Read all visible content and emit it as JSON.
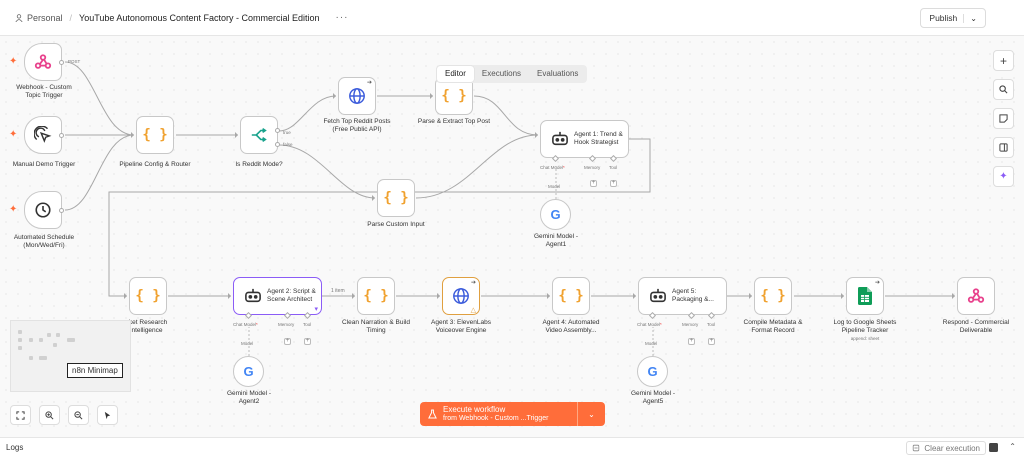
{
  "header": {
    "workspace": "Personal",
    "title": "YouTube Autonomous Content Factory - Commercial Edition",
    "more": "···",
    "publish_label": "Publish",
    "publish_caret": "⌄"
  },
  "tabs": [
    {
      "label": "Editor",
      "active": true
    },
    {
      "label": "Executions",
      "active": false
    },
    {
      "label": "Evaluations",
      "active": false
    }
  ],
  "nodes": {
    "webhook_trigger": "Webhook - Custom\nTopic Trigger",
    "manual_trigger": "Manual Demo Trigger",
    "schedule_trigger": "Automated Schedule\n(Mon/Wed/Fri)",
    "pipeline_config": "Pipeline Config & Router",
    "is_reddit": "Is Reddit Mode?",
    "fetch_reddit": "Fetch Top Reddit Posts\n(Free Public API)",
    "parse_extract": "Parse & Extract Top Post",
    "parse_custom": "Parse Custom Input",
    "agent1": "Agent 1: Trend &\nHook Strategist",
    "gemini1": "Gemini Model -\nAgent1",
    "market_research": "rket Research\n ntelligence",
    "agent2": "Agent 2: Script &\nScene Architect",
    "gemini2": "Gemini Model -\nAgent2",
    "clean_narration": "Clean Narration & Build\nTiming",
    "agent3": "Agent 3: ElevenLabs\nVoiceover Engine",
    "agent4": "Agent 4: Automated\nVideo Assembly...",
    "agent5": "Agent 5:\nPackaging &...",
    "gemini3": "Gemini Model -\nAgent5",
    "compile_metadata": "Compile Metadata &\nFormat Record",
    "sheets": "Log to Google Sheets\nPipeline Tracker",
    "sheets_sub": "append: sheet",
    "respond": "Respond - Commercial\nDeliverable"
  },
  "edge_labels": {
    "post": "POST",
    "true": "true",
    "false": "false",
    "one_item": "1 item"
  },
  "ports": {
    "chat_model": "Chat Model",
    "memory": "Memory",
    "tool": "Tool",
    "model": "Model",
    "required_mark": "*"
  },
  "minimap_tooltip": "n8n Minimap",
  "execute": {
    "label": "Execute workflow",
    "sub": "from Webhook - Custom ...Trigger",
    "caret": "⌄"
  },
  "logs": {
    "label": "Logs",
    "clear_label": "Clear execution",
    "caret": "⌃"
  },
  "colors": {
    "accent": "#ff6d3a",
    "code_brace": "#f0a12e",
    "webhook": "#e8418c",
    "if_node": "#18a28c",
    "http_globe": "#3b5bdb",
    "agent_selected": "#8b5cf6",
    "warning_border": "#e0a040",
    "sheets_green": "#0f9d58"
  },
  "icons": [
    "webhook-icon",
    "cursor-click-icon",
    "clock-icon",
    "code-braces-icon",
    "if-split-icon",
    "globe-icon",
    "robot-icon",
    "google-g-icon",
    "google-sheets-icon",
    "plus-icon",
    "search-icon",
    "note-icon",
    "panel-icon",
    "sparkle-icon",
    "fit-view-icon",
    "zoom-in-icon",
    "zoom-out-icon",
    "pointer-icon",
    "flask-icon",
    "eraser-icon"
  ]
}
